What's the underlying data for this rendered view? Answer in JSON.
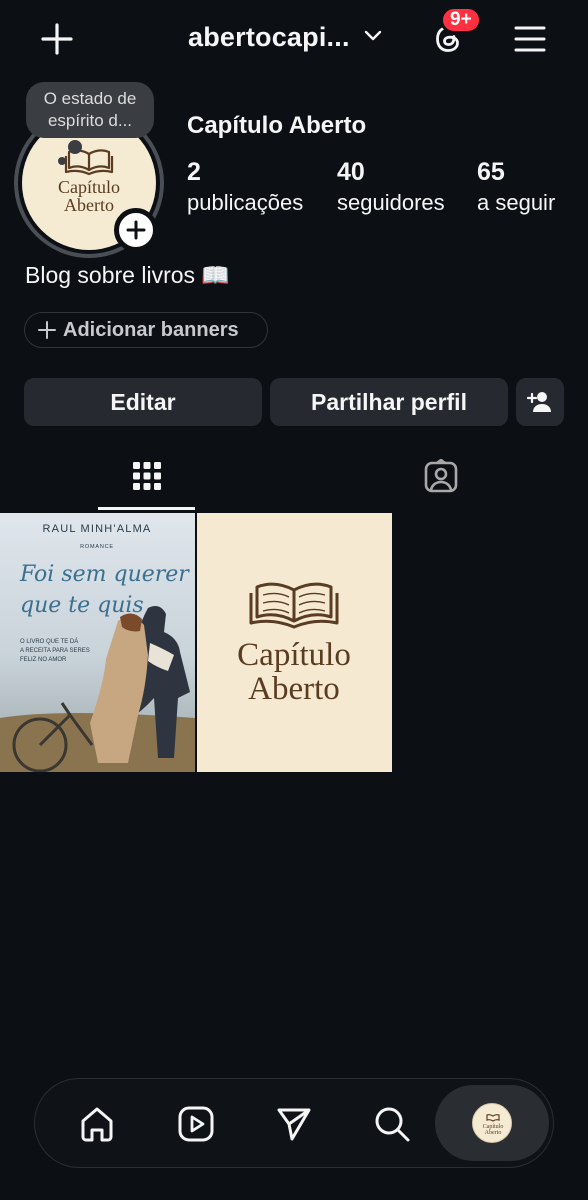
{
  "header": {
    "username": "abertocapi...",
    "badge": "9+"
  },
  "note": {
    "text": "O estado de espírito d..."
  },
  "profile": {
    "name": "Capítulo Aberto",
    "avatar_logo_line1": "Capítulo",
    "avatar_logo_line2": "Aberto",
    "stats": [
      {
        "value": "2",
        "label": "publicações"
      },
      {
        "value": "40",
        "label": "seguidores"
      },
      {
        "value": "65",
        "label": "a seguir"
      }
    ],
    "bio": "Blog sobre livros 📖",
    "banner_button": "Adicionar banners"
  },
  "actions": {
    "edit": "Editar",
    "share": "Partilhar perfil"
  },
  "tabs": [
    {
      "icon": "grid-icon",
      "active": true
    },
    {
      "icon": "tagged-icon",
      "active": false
    }
  ],
  "posts": [
    {
      "author": "RAUL MINH'ALMA",
      "genre": "ROMANCE",
      "title_line1": "Foi sem querer",
      "title_line2": "que te quis",
      "tagline1": "O LIVRO QUE TE DÁ",
      "tagline2": "A RECEITA PARA SERES",
      "tagline3": "FELIZ NO AMOR"
    },
    {
      "logo_line1": "Capítulo",
      "logo_line2": "Aberto"
    }
  ],
  "nav": {
    "items": [
      "home-icon",
      "reels-icon",
      "send-icon",
      "search-icon",
      "profile-avatar"
    ],
    "avatar_line1": "Capítulo",
    "avatar_line2": "Aberto"
  },
  "colors": {
    "background": "#0c1014",
    "button": "#262a30",
    "badge": "#ff3040",
    "logo_bg": "#f5ead2",
    "logo_brown": "#5a3c22"
  }
}
